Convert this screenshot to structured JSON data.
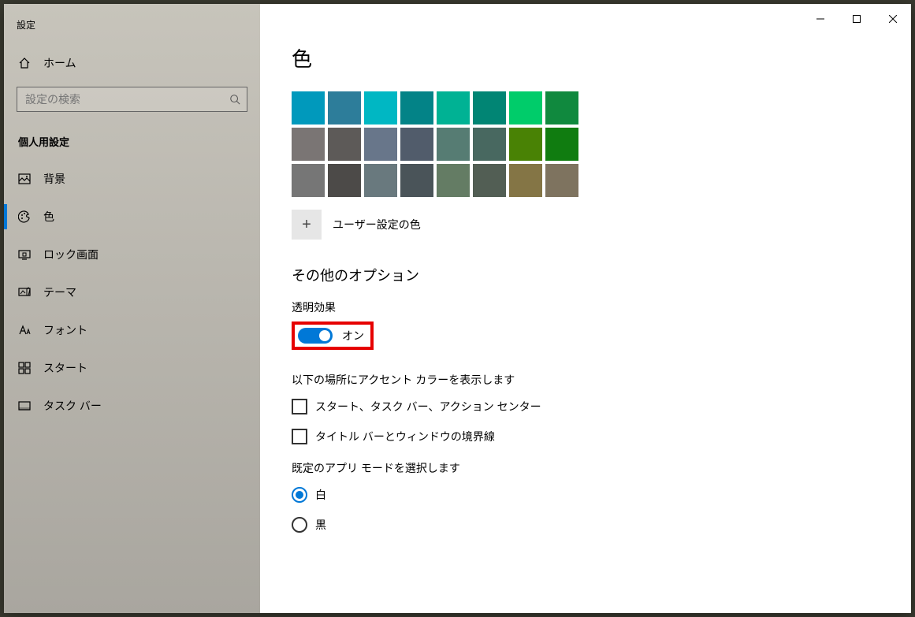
{
  "window": {
    "title": "設定"
  },
  "sidebar": {
    "home": "ホーム",
    "search_placeholder": "設定の検索",
    "category": "個人用設定",
    "items": [
      {
        "icon": "background",
        "label": "背景"
      },
      {
        "icon": "palette",
        "label": "色"
      },
      {
        "icon": "lock-screen",
        "label": "ロック画面"
      },
      {
        "icon": "theme",
        "label": "テーマ"
      },
      {
        "icon": "font",
        "label": "フォント"
      },
      {
        "icon": "start",
        "label": "スタート"
      },
      {
        "icon": "taskbar",
        "label": "タスク バー"
      }
    ],
    "active_index": 1
  },
  "main": {
    "page_title": "色",
    "swatches": [
      [
        "#0099bc",
        "#2d7d9a",
        "#00b7c3",
        "#038387",
        "#00b294",
        "#018574",
        "#00cc6a",
        "#10893e"
      ],
      [
        "#7a7574",
        "#5d5a58",
        "#68768a",
        "#515c6b",
        "#567c73",
        "#486860",
        "#498205",
        "#107c10"
      ],
      [
        "#767676",
        "#4c4a48",
        "#69797e",
        "#4a5459",
        "#647c64",
        "#525e54",
        "#847545",
        "#7e735f"
      ]
    ],
    "custom_color_label": "ユーザー設定の色",
    "other_options_title": "その他のオプション",
    "transparency": {
      "label": "透明効果",
      "state": "on",
      "state_label": "オン"
    },
    "accent_text": "以下の場所にアクセント カラーを表示します",
    "checkboxes": [
      {
        "label": "スタート、タスク バー、アクション センター",
        "checked": false
      },
      {
        "label": "タイトル バーとウィンドウの境界線",
        "checked": false
      }
    ],
    "app_mode_label": "既定のアプリ モードを選択します",
    "radios": [
      {
        "label": "白",
        "selected": true
      },
      {
        "label": "黒",
        "selected": false
      }
    ]
  }
}
